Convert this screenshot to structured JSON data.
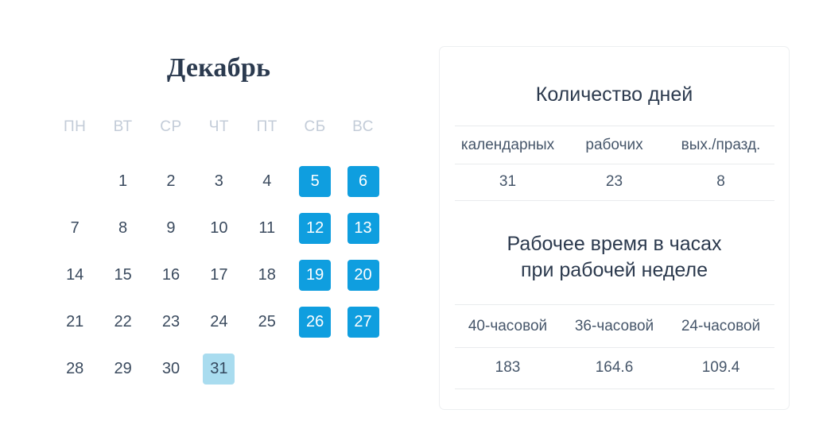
{
  "calendar": {
    "month_title": "Декабрь",
    "weekday_headers": [
      "ПН",
      "ВТ",
      "СР",
      "ЧТ",
      "ПТ",
      "СБ",
      "ВС"
    ],
    "leading_blanks": 1,
    "colors": {
      "weekend_bg": "#0f9edf",
      "weekend_text": "#ffffff",
      "short_day_bg": "#a9dcef",
      "workday_text": "#3a4a5e",
      "weekday_header_text": "#c3ccd8",
      "title_text": "#2b3a4f"
    },
    "days": [
      {
        "num": "1",
        "type": "work"
      },
      {
        "num": "2",
        "type": "work"
      },
      {
        "num": "3",
        "type": "work"
      },
      {
        "num": "4",
        "type": "work"
      },
      {
        "num": "5",
        "type": "weekend"
      },
      {
        "num": "6",
        "type": "weekend"
      },
      {
        "num": "7",
        "type": "work"
      },
      {
        "num": "8",
        "type": "work"
      },
      {
        "num": "9",
        "type": "work"
      },
      {
        "num": "10",
        "type": "work"
      },
      {
        "num": "11",
        "type": "work"
      },
      {
        "num": "12",
        "type": "weekend"
      },
      {
        "num": "13",
        "type": "weekend"
      },
      {
        "num": "14",
        "type": "work"
      },
      {
        "num": "15",
        "type": "work"
      },
      {
        "num": "16",
        "type": "work"
      },
      {
        "num": "17",
        "type": "work"
      },
      {
        "num": "18",
        "type": "work"
      },
      {
        "num": "19",
        "type": "weekend"
      },
      {
        "num": "20",
        "type": "weekend"
      },
      {
        "num": "21",
        "type": "work"
      },
      {
        "num": "22",
        "type": "work"
      },
      {
        "num": "23",
        "type": "work"
      },
      {
        "num": "24",
        "type": "work"
      },
      {
        "num": "25",
        "type": "work"
      },
      {
        "num": "26",
        "type": "weekend"
      },
      {
        "num": "27",
        "type": "weekend"
      },
      {
        "num": "28",
        "type": "work"
      },
      {
        "num": "29",
        "type": "work"
      },
      {
        "num": "30",
        "type": "work"
      },
      {
        "num": "31",
        "type": "short"
      }
    ]
  },
  "panel": {
    "days_section": {
      "heading": "Количество дней",
      "columns": [
        "календарных",
        "рабочих",
        "вых./празд."
      ],
      "values": [
        "31",
        "23",
        "8"
      ]
    },
    "hours_section": {
      "heading_line1": "Рабочее время в часах",
      "heading_line2": "при рабочей неделе",
      "columns": [
        "40-часовой",
        "36-часовой",
        "24-часовой"
      ],
      "values": [
        "183",
        "164.6",
        "109.4"
      ]
    }
  }
}
